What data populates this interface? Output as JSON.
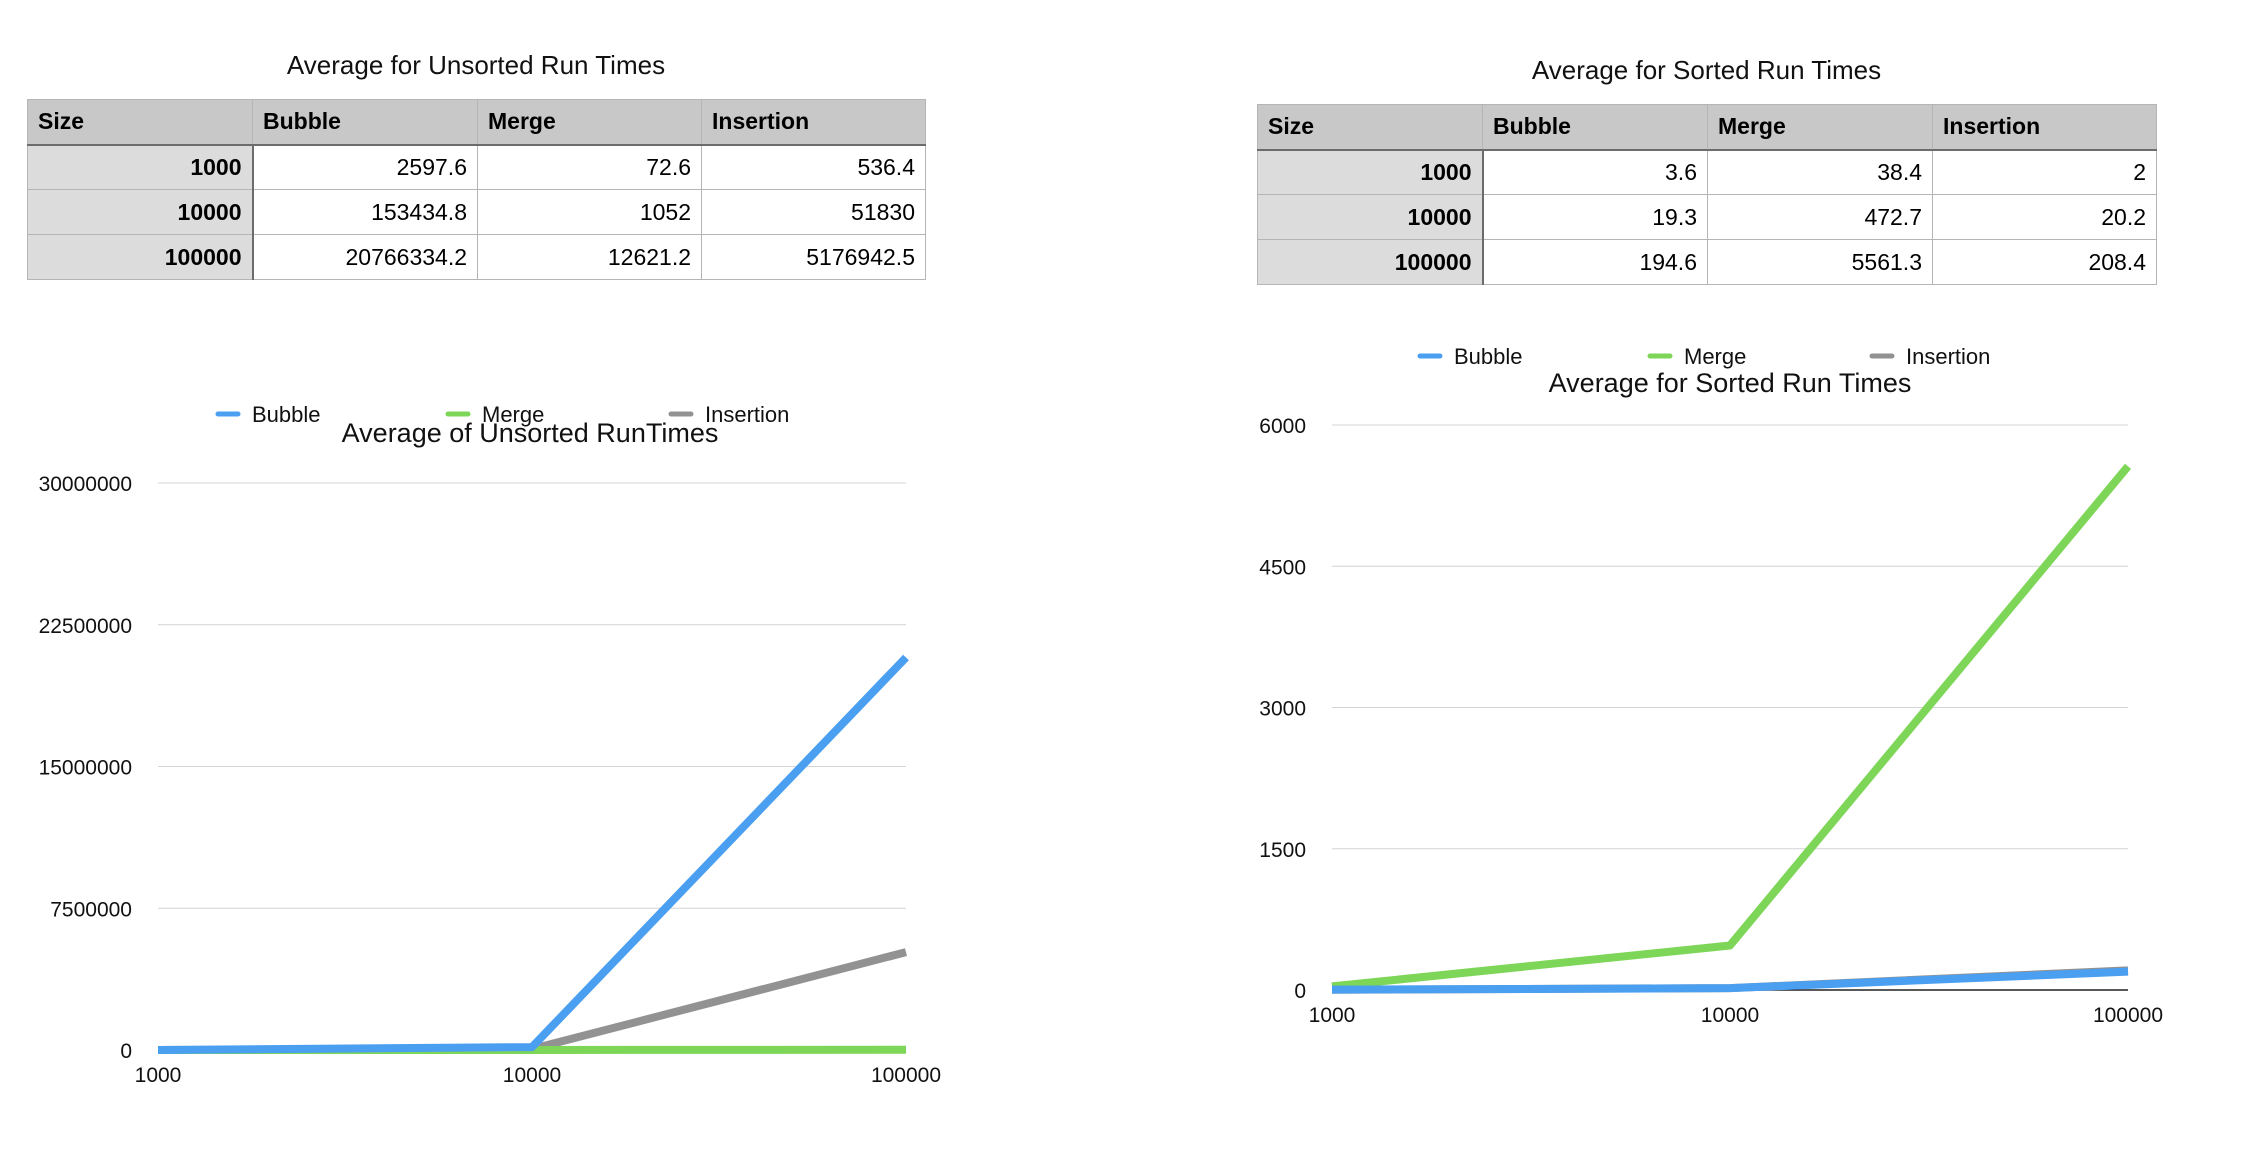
{
  "tables": [
    {
      "title": "Average for Unsorted Run Times",
      "headers": [
        "Size",
        "Bubble",
        "Merge",
        "Insertion"
      ],
      "rows": [
        [
          "1000",
          "2597.6",
          "72.6",
          "536.4"
        ],
        [
          "10000",
          "153434.8",
          "1052",
          "51830"
        ],
        [
          "100000",
          "20766334.2",
          "12621.2",
          "5176942.5"
        ]
      ]
    },
    {
      "title": "Average for Sorted Run Times",
      "headers": [
        "Size",
        "Bubble",
        "Merge",
        "Insertion"
      ],
      "rows": [
        [
          "1000",
          "3.6",
          "38.4",
          "2"
        ],
        [
          "10000",
          "19.3",
          "472.7",
          "20.2"
        ],
        [
          "100000",
          "194.6",
          "5561.3",
          "208.4"
        ]
      ]
    }
  ],
  "chart_data": [
    {
      "type": "line",
      "title": "Average of Unsorted RunTimes",
      "xlabel": "",
      "ylabel": "",
      "categories": [
        "1000",
        "10000",
        "100000"
      ],
      "ylim": [
        0,
        30000000
      ],
      "yticks": [
        0,
        7500000,
        15000000,
        22500000,
        30000000
      ],
      "grid": true,
      "legend_position": "top",
      "series": [
        {
          "name": "Bubble",
          "values": [
            2597.6,
            153434.8,
            20766334.2
          ],
          "color": "#4a9ff0"
        },
        {
          "name": "Merge",
          "values": [
            72.6,
            1052,
            12621.2
          ],
          "color": "#7dd657"
        },
        {
          "name": "Insertion",
          "values": [
            536.4,
            51830,
            5176942.5
          ],
          "color": "#929292"
        }
      ]
    },
    {
      "type": "line",
      "title": "Average for Sorted Run Times",
      "xlabel": "",
      "ylabel": "",
      "categories": [
        "1000",
        "10000",
        "100000"
      ],
      "ylim": [
        0,
        6000
      ],
      "yticks": [
        0,
        1500,
        3000,
        4500,
        6000
      ],
      "grid": true,
      "legend_position": "top",
      "series": [
        {
          "name": "Bubble",
          "values": [
            3.6,
            19.3,
            194.6
          ],
          "color": "#4a9ff0"
        },
        {
          "name": "Merge",
          "values": [
            38.4,
            472.7,
            5561.3
          ],
          "color": "#7dd657"
        },
        {
          "name": "Insertion",
          "values": [
            2,
            20.2,
            208.4
          ],
          "color": "#929292"
        }
      ]
    }
  ]
}
